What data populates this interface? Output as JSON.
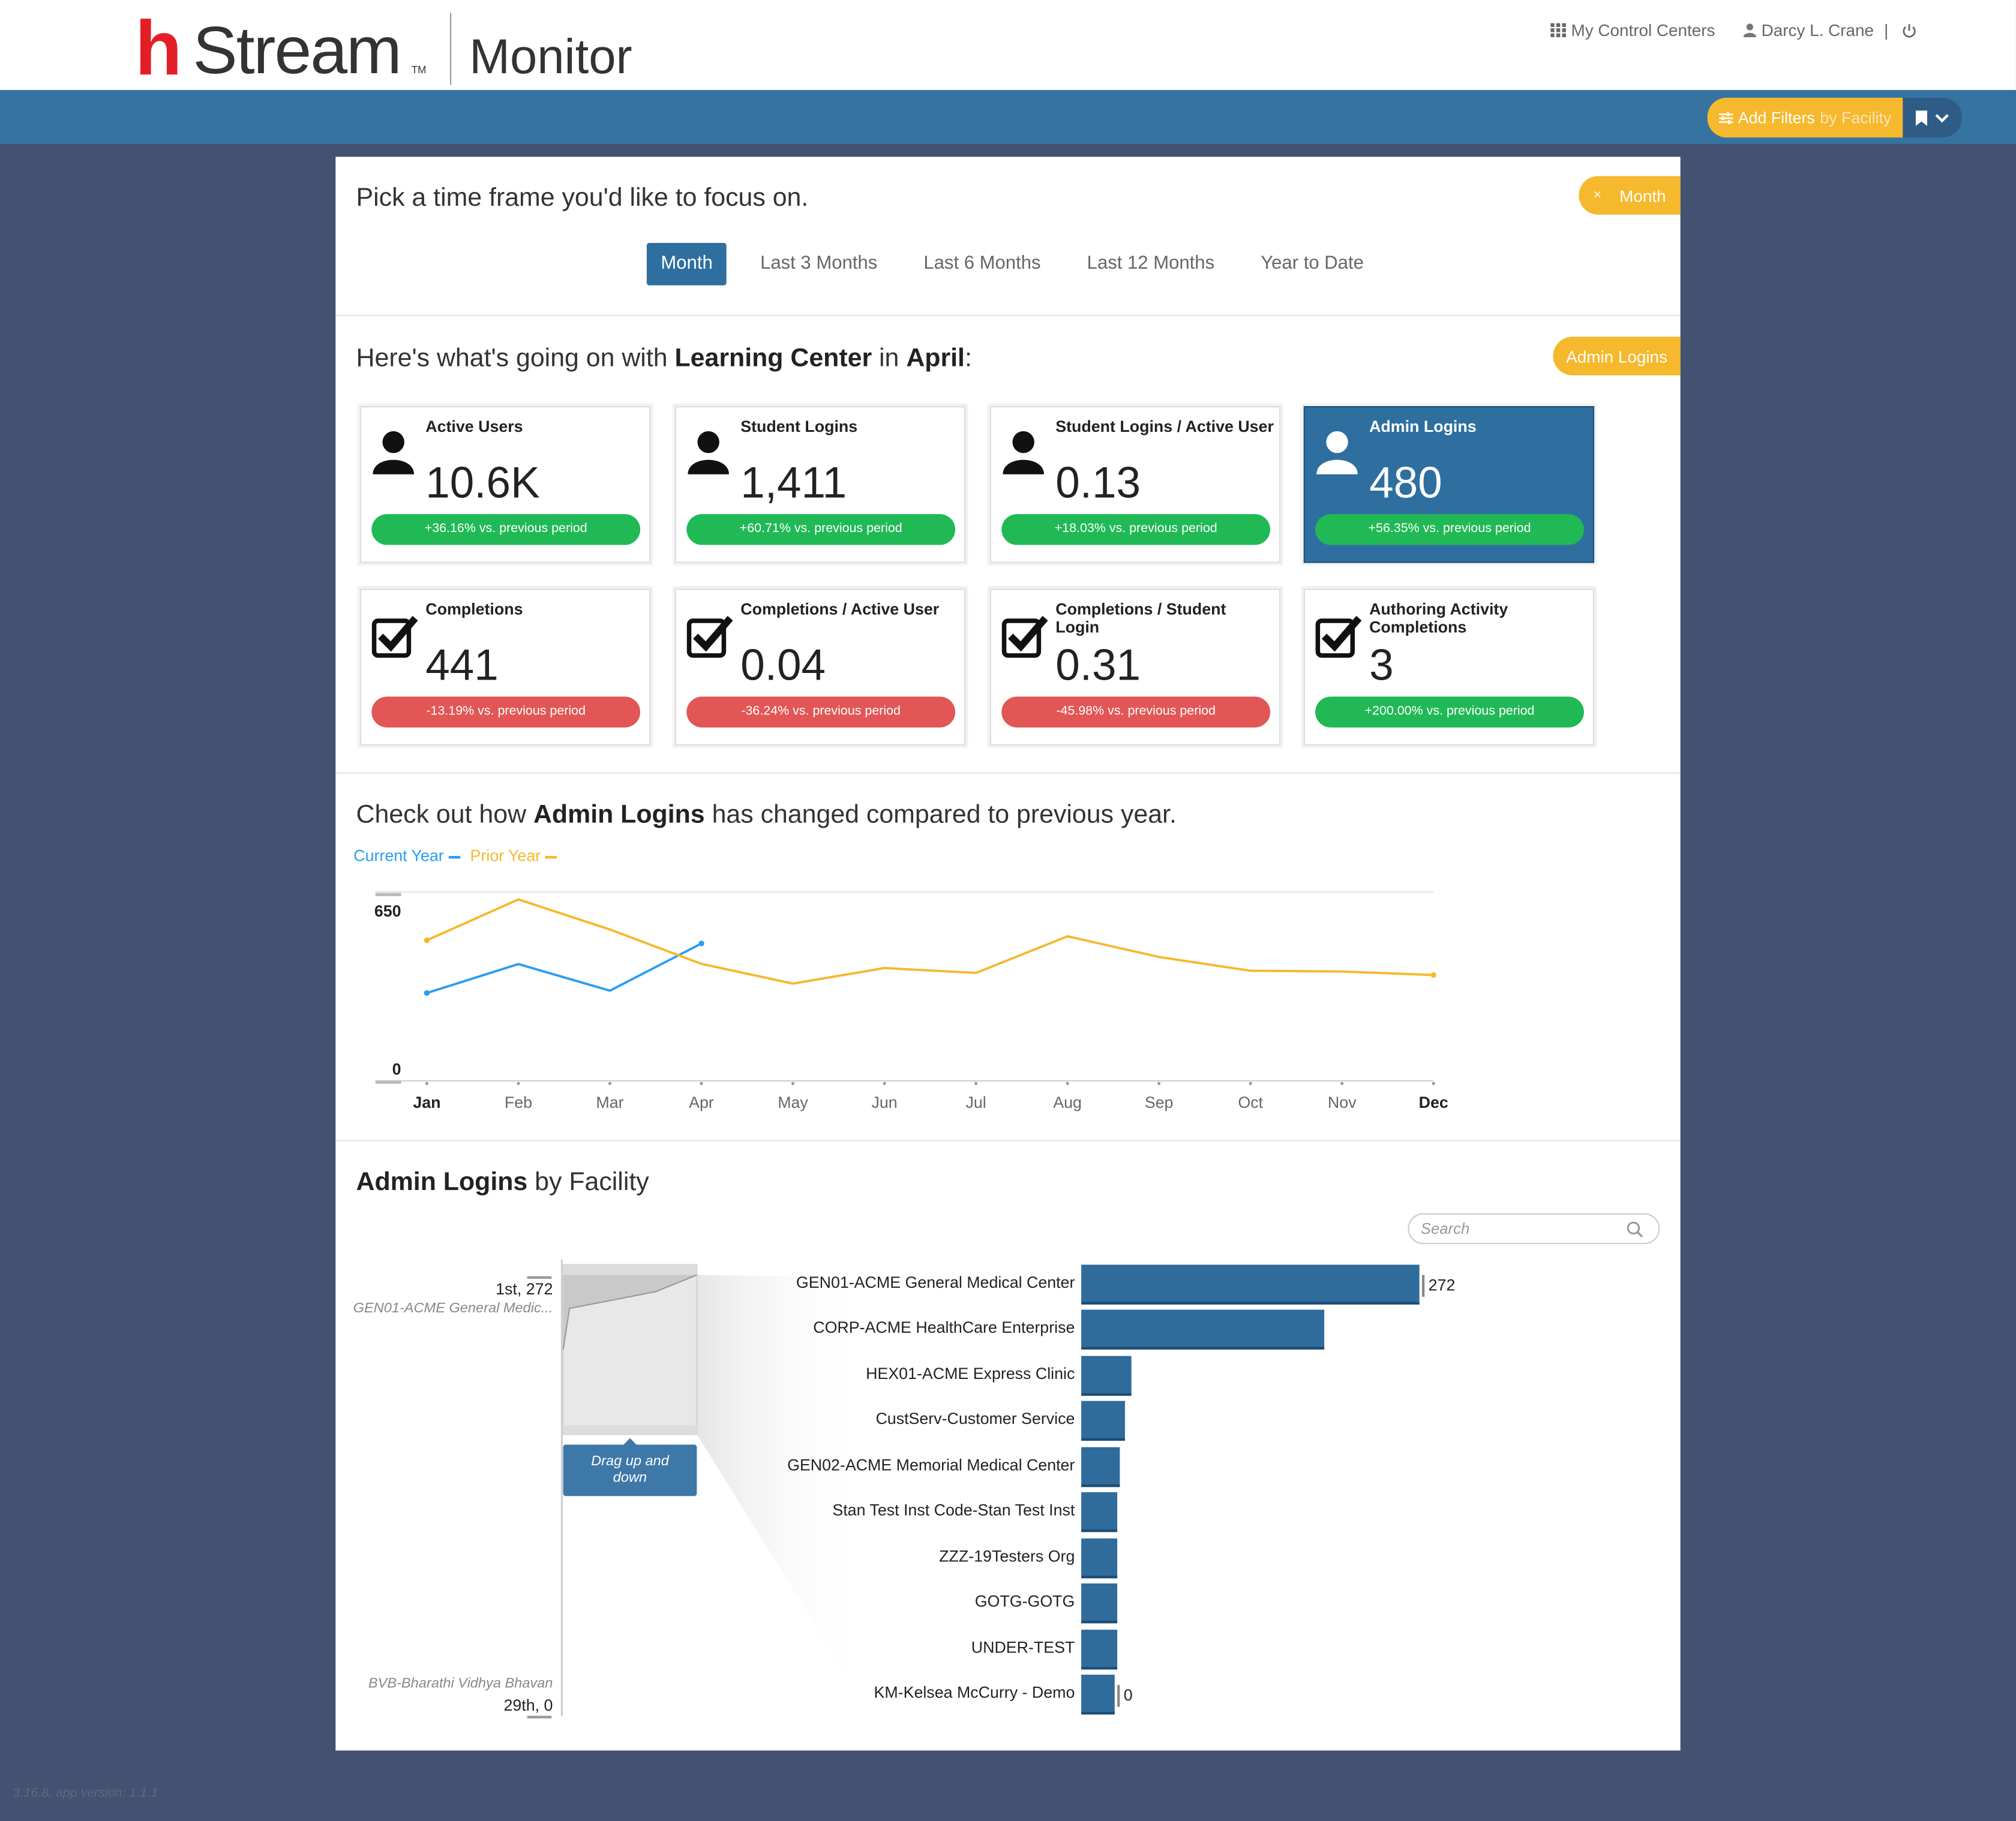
{
  "header": {
    "brand_h": "h",
    "brand_rest": "Stream",
    "brand_tm": "TM",
    "app_name": "Monitor",
    "control_centers": "My Control Centers",
    "user_name": "Darcy L. Crane",
    "user_sep": "|",
    "add_filters": "Add Filters",
    "add_filters_by": "by Facility"
  },
  "timeframe": {
    "prompt": "Pick a time frame you'd like to focus on.",
    "selected_chip": "Month",
    "chip_close": "×",
    "tabs": [
      "Month",
      "Last 3 Months",
      "Last 6 Months",
      "Last 12 Months",
      "Year to Date"
    ]
  },
  "summary": {
    "prefix": "Here's what's going on with",
    "center": "Learning Center",
    "mid": "in",
    "month": "April",
    "suffix": ":",
    "metric_chip": "Admin Logins",
    "cards": [
      {
        "title": "Active Users",
        "value": "10.6K",
        "change": "+36.16% vs. previous period",
        "trend": "up",
        "icon": "user-icon"
      },
      {
        "title": "Student Logins",
        "value": "1,411",
        "change": "+60.71% vs. previous period",
        "trend": "up",
        "icon": "user-icon"
      },
      {
        "title": "Student Logins / Active User",
        "value": "0.13",
        "change": "+18.03% vs. previous period",
        "trend": "up",
        "icon": "user-icon"
      },
      {
        "title": "Admin Logins",
        "value": "480",
        "change": "+56.35% vs. previous period",
        "trend": "up",
        "icon": "user-icon",
        "selected": true
      },
      {
        "title": "Completions",
        "value": "441",
        "change": "-13.19% vs. previous period",
        "trend": "down",
        "icon": "checkbox-icon"
      },
      {
        "title": "Completions / Active User",
        "value": "0.04",
        "change": "-36.24% vs. previous period",
        "trend": "down",
        "icon": "checkbox-icon"
      },
      {
        "title": "Completions / Student Login",
        "value": "0.31",
        "change": "-45.98% vs. previous period",
        "trend": "down",
        "icon": "checkbox-icon"
      },
      {
        "title": "Authoring Activity Completions",
        "value": "3",
        "change": "+200.00% vs. previous period",
        "trend": "up",
        "icon": "checkbox-icon"
      }
    ]
  },
  "trend": {
    "prefix": "Check out how",
    "metric": "Admin Logins",
    "suffix": "has changed compared to previous year."
  },
  "facility": {
    "metric": "Admin Logins",
    "suffix": "by Facility",
    "search_placeholder": "Search",
    "top_rank": "1st, 272",
    "top_name": "GEN01-ACME General Medic...",
    "bottom_name": "BVB-Bharathi Vidhya Bhavan",
    "bottom_rank": "29th, 0",
    "drag_hint": "Drag up and down"
  },
  "colors": {
    "brand_red": "#e41e26",
    "header_blue": "#3773a1",
    "accent_orange": "#f6b82c",
    "selected_blue": "#2e6fa0",
    "positive_green": "#20b956",
    "negative_red": "#e25656",
    "current_year_line": "#2a9df4",
    "prior_year_line": "#f6b82c",
    "background": "#435270"
  },
  "footer": {
    "version": "3.16.8, app version: 1.1.1"
  },
  "chart_data": [
    {
      "type": "line",
      "categories": [
        "Jan",
        "Feb",
        "Mar",
        "Apr",
        "May",
        "Jun",
        "Jul",
        "Aug",
        "Sep",
        "Oct",
        "Nov",
        "Dec"
      ],
      "series": [
        {
          "name": "Current Year",
          "values": [
            307,
            408,
            315,
            480
          ]
        },
        {
          "name": "Prior Year",
          "values": [
            491,
            634,
            529,
            409,
            340,
            394,
            377,
            505,
            433,
            385,
            382,
            370
          ]
        }
      ],
      "yticks": [
        0,
        650
      ],
      "ylim": [
        0,
        660
      ]
    },
    {
      "type": "bar",
      "orientation": "horizontal",
      "categories": [
        "GEN01-ACME General Medical Center",
        "CORP-ACME HealthCare Enterprise",
        "HEX01-ACME Express Clinic",
        "CustServ-Customer Service",
        "GEN02-ACME Memorial Medical Center",
        "Stan Test Inst Code-Stan Test Inst",
        "ZZZ-19Testers Org",
        "GOTG-GOTG",
        "UNDER-TEST",
        "KM-Kelsea McCurry - Demo"
      ],
      "values": [
        272,
        195,
        40,
        35,
        31,
        29,
        29,
        29,
        29,
        0
      ],
      "value_labels": [
        "272",
        "",
        "",
        "",
        "",
        "",
        "",
        "",
        "",
        "0"
      ]
    }
  ]
}
